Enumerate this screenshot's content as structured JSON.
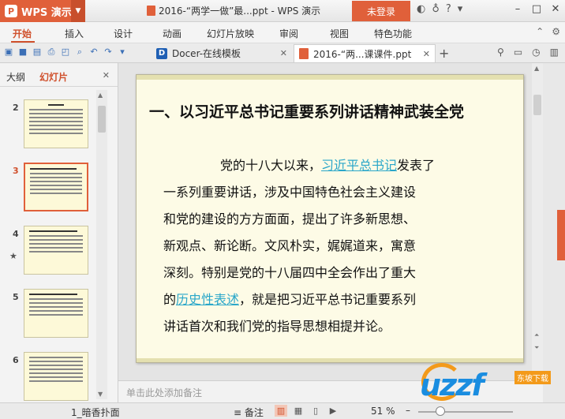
{
  "titlebar": {
    "app_name": "WPS 演示",
    "doc_title": "2016-“两学一做”最...ppt - WPS 演示",
    "login_label": "未登录",
    "icons": [
      "skin-icon",
      "shirt-icon",
      "help-icon",
      "more-icon"
    ],
    "window_controls": [
      "minimize-icon",
      "maximize-icon",
      "close-icon"
    ]
  },
  "menu": {
    "items": [
      "开始",
      "插入",
      "设计",
      "动画",
      "幻灯片放映",
      "审阅",
      "视图",
      "特色功能"
    ],
    "active_index": 0
  },
  "tabs": {
    "docer_label": "Docer-在线模板",
    "ppt_label": "2016-“两...课课件.ppt",
    "add_tab": "+"
  },
  "leftpanel": {
    "tab_outline": "大纲",
    "tab_slides": "幻灯片",
    "thumbs": [
      {
        "num": "2",
        "selected": false,
        "star": false
      },
      {
        "num": "3",
        "selected": true,
        "star": false
      },
      {
        "num": "4",
        "selected": false,
        "star": true
      },
      {
        "num": "5",
        "selected": false,
        "star": false
      },
      {
        "num": "6",
        "selected": false,
        "star": false
      }
    ]
  },
  "slide": {
    "title": "一、以习近平总书记重要系列讲话精神武装全党",
    "line1_pre": "党的十八大以来，",
    "line1_link": "习近平总书记",
    "line1_post": "发表了",
    "line2": "一系列重要讲话，涉及中国特色社会主义建设",
    "line3": "和党的建设的方方面面，提出了许多新思想、",
    "line4": "新观点、新论断。文风朴实，娓娓道来，寓意",
    "line5": "深刻。特别是党的十八届四中全会作出了重大",
    "line6_pre": "的",
    "line6_link": "历史性表述",
    "line6_post": "，就是把习近平总书记重要系列",
    "line7": "讲话首次和我们党的指导思想相提并论。"
  },
  "notes": {
    "placeholder": "单击此处添加备注"
  },
  "statusbar": {
    "theme": "1_暗香扑面",
    "notes_label": "备注",
    "zoom": "51 %"
  },
  "watermark": {
    "logo": "uzzf",
    "tag": "东坡下载"
  },
  "colors": {
    "accent": "#e0603a",
    "link": "#2aa7c9",
    "slide_bg": "#fdfbe6"
  }
}
